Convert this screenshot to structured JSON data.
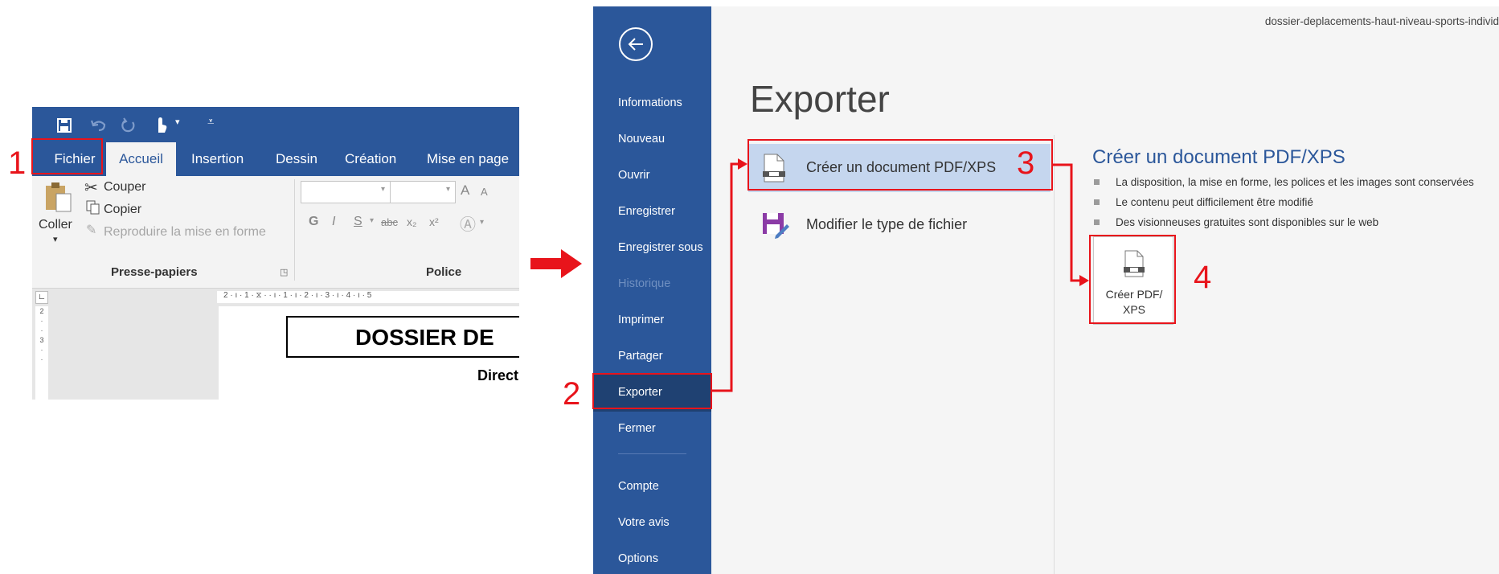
{
  "word": {
    "tabs": [
      "Fichier",
      "Accueil",
      "Insertion",
      "Dessin",
      "Création",
      "Mise en page"
    ],
    "clipboard": {
      "paste": "Coller",
      "cut": "Couper",
      "copy": "Copier",
      "format_painter": "Reproduire la mise en forme",
      "group_label": "Presse-papiers"
    },
    "font": {
      "group_label": "Police",
      "bold": "G",
      "italic": "I",
      "underline": "S",
      "strike": "abc",
      "subscript": "x₂",
      "superscript": "x²",
      "grow": "A",
      "shrink": "A"
    },
    "ruler_text": "2 · ı · 1 · ⧖ ·  · ı · 1 · ı · 2 · ı · 3 · ı · 4 · ı · 5",
    "doc_title": "DOSSIER DE",
    "doc_subtitle": "Direct"
  },
  "backstage": {
    "filename": "dossier-deplacements-haut-niveau-sports-individ",
    "title": "Exporter",
    "nav": [
      {
        "label": "Informations",
        "state": "normal"
      },
      {
        "label": "Nouveau",
        "state": "normal"
      },
      {
        "label": "Ouvrir",
        "state": "normal"
      },
      {
        "label": "Enregistrer",
        "state": "normal"
      },
      {
        "label": "Enregistrer sous",
        "state": "normal"
      },
      {
        "label": "Historique",
        "state": "disabled"
      },
      {
        "label": "Imprimer",
        "state": "normal"
      },
      {
        "label": "Partager",
        "state": "normal"
      },
      {
        "label": "Exporter",
        "state": "selected"
      },
      {
        "label": "Fermer",
        "state": "normal"
      },
      {
        "label": "Compte",
        "state": "normal"
      },
      {
        "label": "Votre avis",
        "state": "normal"
      },
      {
        "label": "Options",
        "state": "normal"
      }
    ],
    "options": [
      {
        "label": "Créer un document PDF/XPS",
        "icon": "pdf-document-icon",
        "selected": true
      },
      {
        "label": "Modifier le type de fichier",
        "icon": "change-file-type-icon",
        "selected": false
      }
    ],
    "detail_title": "Créer un document PDF/XPS",
    "bullets": [
      "La disposition, la mise en forme, les polices et les images sont conservées",
      "Le contenu peut difficilement être modifié",
      "Des visionneuses gratuites sont disponibles sur le web"
    ],
    "create_button": {
      "line1": "Créer PDF/",
      "line2": "XPS"
    }
  },
  "annotations": {
    "step1": "1",
    "step2": "2",
    "step3": "3",
    "step4": "4"
  },
  "colors": {
    "word_blue": "#2b579a",
    "selected_nav": "#1f4172",
    "highlight": "#c5d6ee",
    "annotation_red": "#e8141b"
  }
}
